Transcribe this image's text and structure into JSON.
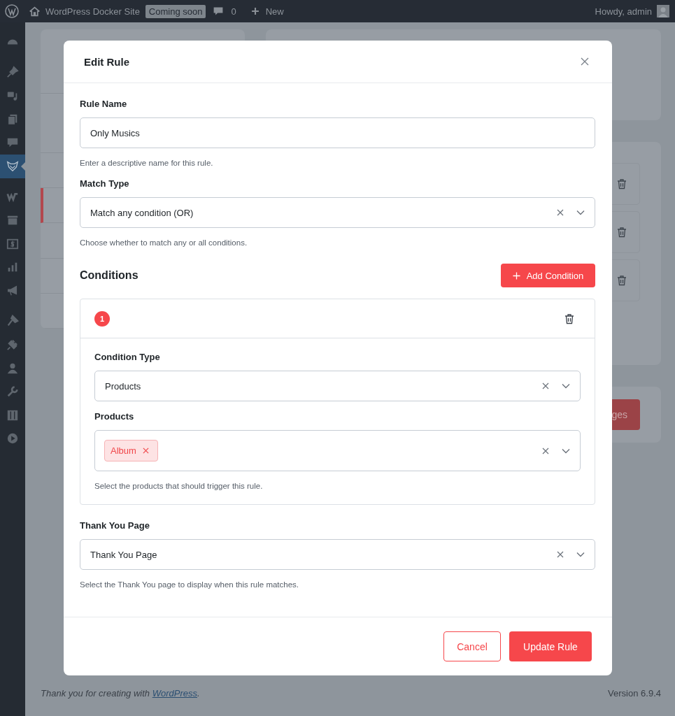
{
  "admin_bar": {
    "site_name": "WordPress Docker Site",
    "badge": "Coming soon",
    "comments": "0",
    "new": "New",
    "greeting": "Howdy, admin"
  },
  "sidebar": {
    "items": [
      {
        "selected": false
      },
      {
        "selected": false
      },
      {
        "selected": false
      },
      {
        "selected": false
      },
      {
        "selected": false
      },
      {
        "selected": true
      },
      {
        "selected": false
      },
      {
        "selected": false
      },
      {
        "selected": false
      },
      {
        "selected": false
      },
      {
        "selected": false
      },
      {
        "selected": false
      },
      {
        "selected": false
      },
      {
        "selected": false
      },
      {
        "selected": false
      },
      {
        "selected": false
      },
      {
        "selected": false
      }
    ]
  },
  "background": {
    "menu_rows": [
      {
        "selected": false
      },
      {
        "selected": true
      },
      {
        "selected": false
      },
      {
        "selected": false
      },
      {
        "selected": false
      }
    ],
    "button": "ges"
  },
  "modal": {
    "title": "Edit Rule",
    "fields": [
      {
        "kind": "text",
        "label": "Rule Name",
        "value": "Only Musics",
        "help": "Enter a descriptive name for this rule."
      },
      {
        "kind": "select",
        "label": "Match Type",
        "value": "Match any condition (OR)",
        "help": "Choose whether to match any or all conditions."
      }
    ],
    "conditions": {
      "title": "Conditions",
      "add_button": "Add Condition",
      "items": [
        {
          "number": "1",
          "fields": [
            {
              "kind": "select",
              "label": "Condition Type",
              "value": "Products"
            },
            {
              "kind": "multiselect",
              "label": "Products",
              "tags": [
                "Album"
              ],
              "help": "Select the products that should trigger this rule."
            }
          ]
        }
      ]
    },
    "after_fields": [
      {
        "kind": "select",
        "label": "Thank You Page",
        "value": "Thank You Page",
        "help": "Select the Thank You page to display when this rule matches."
      }
    ],
    "cancel": "Cancel",
    "submit": "Update Rule"
  },
  "footer": {
    "text": "Thank you for creating with",
    "link": "WordPress",
    "after": ".",
    "version": "Version 6.9.4"
  }
}
